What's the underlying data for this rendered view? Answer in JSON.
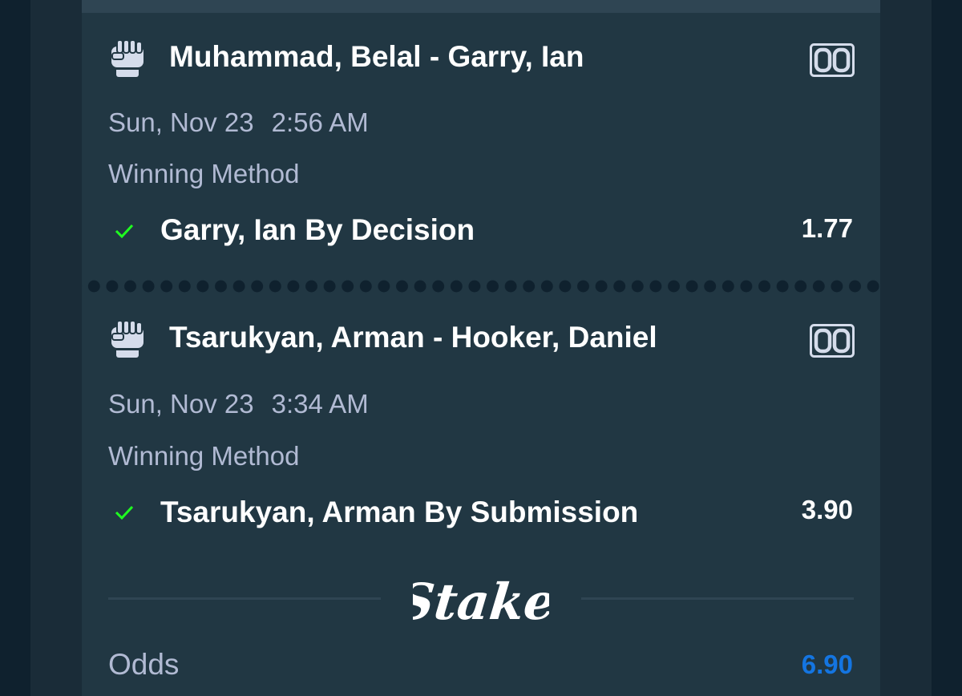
{
  "legs": [
    {
      "sport_icon": "fist-icon",
      "live_icon": "scoreboard-icon",
      "title": "Muhammad, Belal - Garry, Ian",
      "date": "Sun, Nov 23",
      "time": "2:56 AM",
      "market": "Winning Method",
      "status_icon": "check-icon",
      "selection": "Garry, Ian By Decision",
      "odds": "1.77"
    },
    {
      "sport_icon": "fist-icon",
      "live_icon": "scoreboard-icon",
      "title": "Tsarukyan, Arman - Hooker, Daniel",
      "date": "Sun, Nov 23",
      "time": "3:34 AM",
      "market": "Winning Method",
      "status_icon": "check-icon",
      "selection": "Tsarukyan, Arman By Submission",
      "odds": "3.90"
    }
  ],
  "brand": {
    "logo_text": "Stake"
  },
  "summary": {
    "odds_label": "Odds",
    "odds_value": "6.90"
  },
  "colors": {
    "background": "#1a2c38",
    "card": "#213743",
    "text_primary": "#ffffff",
    "text_secondary": "#b1bad3",
    "win_check": "#1fff20",
    "odds_accent": "#1475e1"
  }
}
